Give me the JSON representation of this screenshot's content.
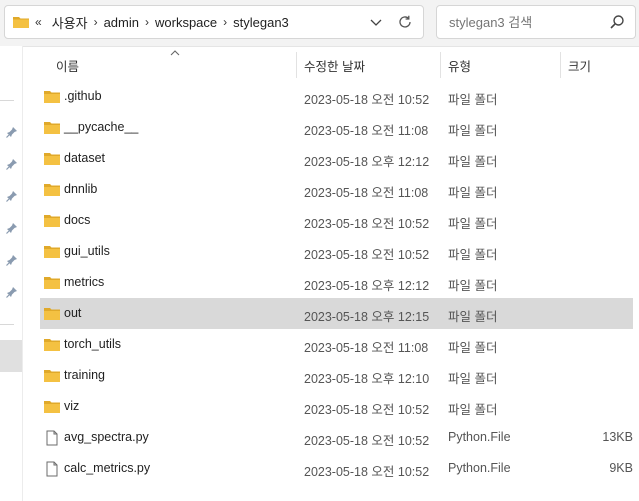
{
  "address": {
    "lead_glyph": "«",
    "crumbs": [
      "사용자",
      "admin",
      "workspace",
      "stylegan3"
    ],
    "separator": "›"
  },
  "search": {
    "placeholder": "stylegan3 검색"
  },
  "columns": {
    "name": "이름",
    "date": "수정한 날짜",
    "type": "유형",
    "size": "크기"
  },
  "files": [
    {
      "name": ".github",
      "date": "2023-05-18 오전 10:52",
      "type": "파일 폴더",
      "size": "",
      "icon": "folder-icon"
    },
    {
      "name": "__pycache__",
      "date": "2023-05-18 오전 11:08",
      "type": "파일 폴더",
      "size": "",
      "icon": "folder-icon"
    },
    {
      "name": "dataset",
      "date": "2023-05-18 오후 12:12",
      "type": "파일 폴더",
      "size": "",
      "icon": "folder-icon"
    },
    {
      "name": "dnnlib",
      "date": "2023-05-18 오전 11:08",
      "type": "파일 폴더",
      "size": "",
      "icon": "folder-icon"
    },
    {
      "name": "docs",
      "date": "2023-05-18 오전 10:52",
      "type": "파일 폴더",
      "size": "",
      "icon": "folder-icon"
    },
    {
      "name": "gui_utils",
      "date": "2023-05-18 오전 10:52",
      "type": "파일 폴더",
      "size": "",
      "icon": "folder-icon"
    },
    {
      "name": "metrics",
      "date": "2023-05-18 오후 12:12",
      "type": "파일 폴더",
      "size": "",
      "icon": "folder-icon"
    },
    {
      "name": "out",
      "date": "2023-05-18 오후 12:15",
      "type": "파일 폴더",
      "size": "",
      "icon": "folder-icon",
      "selected": true
    },
    {
      "name": "torch_utils",
      "date": "2023-05-18 오전 11:08",
      "type": "파일 폴더",
      "size": "",
      "icon": "folder-icon"
    },
    {
      "name": "training",
      "date": "2023-05-18 오후 12:10",
      "type": "파일 폴더",
      "size": "",
      "icon": "folder-icon"
    },
    {
      "name": "viz",
      "date": "2023-05-18 오전 10:52",
      "type": "파일 폴더",
      "size": "",
      "icon": "folder-icon"
    },
    {
      "name": "avg_spectra.py",
      "date": "2023-05-18 오전 10:52",
      "type": "Python.File",
      "size": "13KB",
      "icon": "file-icon"
    },
    {
      "name": "calc_metrics.py",
      "date": "2023-05-18 오전 10:52",
      "type": "Python.File",
      "size": "9KB",
      "icon": "file-icon"
    }
  ],
  "colors": {
    "folder": "#f4c142",
    "folder_dark": "#e0a92a",
    "selection": "#d9d9d9",
    "accent": "#0067c0"
  }
}
